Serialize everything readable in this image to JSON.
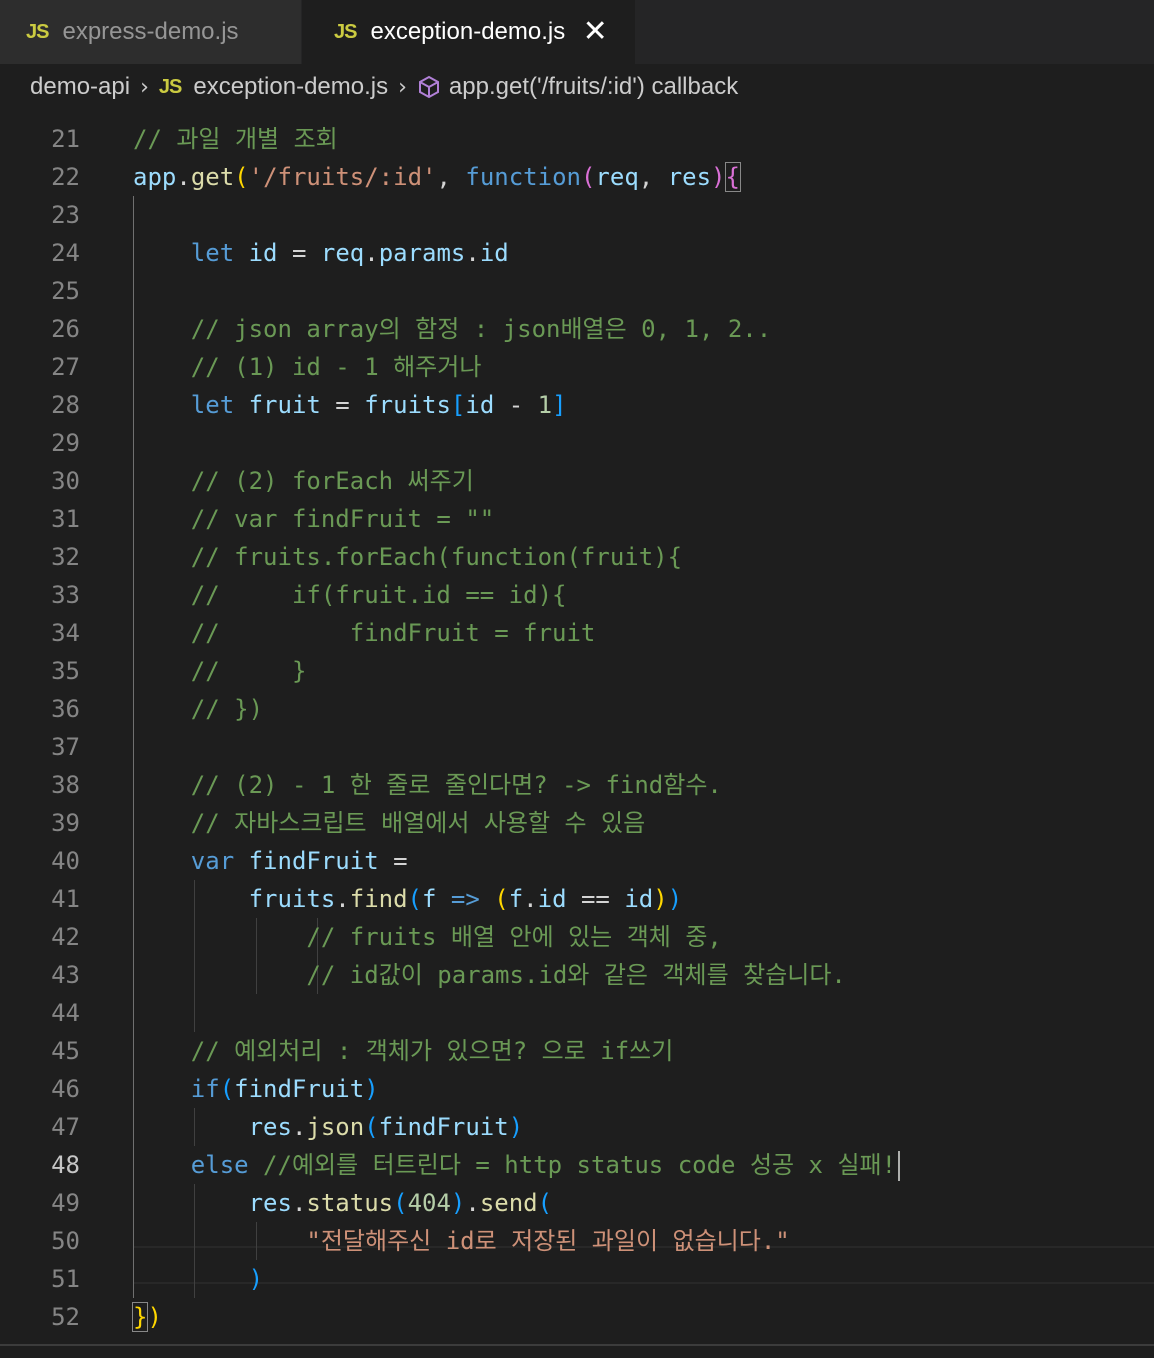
{
  "tabs": [
    {
      "icon": "JS",
      "label": "express-demo.js",
      "active": false
    },
    {
      "icon": "JS",
      "label": "exception-demo.js",
      "active": true,
      "close": "✕"
    }
  ],
  "breadcrumb": {
    "folder": "demo-api",
    "file_icon": "JS",
    "file": "exception-demo.js",
    "symbol": "app.get('/fruits/:id') callback"
  },
  "editor": {
    "current_line": 48,
    "lines": [
      {
        "n": "21",
        "tokens": [
          [
            "cm",
            "// 과일 개별 조회"
          ]
        ]
      },
      {
        "n": "22",
        "tokens": [
          [
            "vr",
            "app"
          ],
          [
            "",
            "."
          ],
          [
            "fn",
            "get"
          ],
          [
            "br1",
            "("
          ],
          [
            "st",
            "'/fruits/:id'"
          ],
          [
            "",
            ", "
          ],
          [
            "kw",
            "function"
          ],
          [
            "br2",
            "("
          ],
          [
            "vr",
            "req"
          ],
          [
            "",
            ", "
          ],
          [
            "vr",
            "res"
          ],
          [
            "br2",
            ")"
          ],
          [
            "br2box",
            "{"
          ]
        ]
      },
      {
        "n": "23",
        "tokens": []
      },
      {
        "n": "24",
        "tokens": [
          [
            "",
            "    "
          ],
          [
            "kw",
            "let"
          ],
          [
            "",
            " "
          ],
          [
            "vr",
            "id"
          ],
          [
            "",
            " = "
          ],
          [
            "vr",
            "req"
          ],
          [
            "",
            "."
          ],
          [
            "vr",
            "params"
          ],
          [
            "",
            "."
          ],
          [
            "vr",
            "id"
          ]
        ]
      },
      {
        "n": "25",
        "tokens": []
      },
      {
        "n": "26",
        "tokens": [
          [
            "",
            "    "
          ],
          [
            "cm",
            "// json array의 함정 : json배열은 0, 1, 2.."
          ]
        ]
      },
      {
        "n": "27",
        "tokens": [
          [
            "",
            "    "
          ],
          [
            "cm",
            "// (1) id - 1 해주거나"
          ]
        ]
      },
      {
        "n": "28",
        "tokens": [
          [
            "",
            "    "
          ],
          [
            "kw",
            "let"
          ],
          [
            "",
            " "
          ],
          [
            "vr",
            "fruit"
          ],
          [
            "",
            " = "
          ],
          [
            "vr",
            "fruits"
          ],
          [
            "br3",
            "["
          ],
          [
            "vr",
            "id"
          ],
          [
            "",
            " - "
          ],
          [
            "nm",
            "1"
          ],
          [
            "br3",
            "]"
          ]
        ]
      },
      {
        "n": "29",
        "tokens": []
      },
      {
        "n": "30",
        "tokens": [
          [
            "",
            "    "
          ],
          [
            "cm",
            "// (2) forEach 써주기"
          ]
        ]
      },
      {
        "n": "31",
        "tokens": [
          [
            "",
            "    "
          ],
          [
            "cm",
            "// var findFruit = \"\""
          ]
        ]
      },
      {
        "n": "32",
        "tokens": [
          [
            "",
            "    "
          ],
          [
            "cm",
            "// fruits.forEach(function(fruit){"
          ]
        ]
      },
      {
        "n": "33",
        "tokens": [
          [
            "",
            "    "
          ],
          [
            "cm",
            "//     if(fruit.id == id){"
          ]
        ]
      },
      {
        "n": "34",
        "tokens": [
          [
            "",
            "    "
          ],
          [
            "cm",
            "//         findFruit = fruit"
          ]
        ]
      },
      {
        "n": "35",
        "tokens": [
          [
            "",
            "    "
          ],
          [
            "cm",
            "//     }"
          ]
        ]
      },
      {
        "n": "36",
        "tokens": [
          [
            "",
            "    "
          ],
          [
            "cm",
            "// })"
          ]
        ]
      },
      {
        "n": "37",
        "tokens": []
      },
      {
        "n": "38",
        "tokens": [
          [
            "",
            "    "
          ],
          [
            "cm",
            "// (2) - 1 한 줄로 줄인다면? -> find함수."
          ]
        ]
      },
      {
        "n": "39",
        "tokens": [
          [
            "",
            "    "
          ],
          [
            "cm",
            "// 자바스크립트 배열에서 사용할 수 있음"
          ]
        ]
      },
      {
        "n": "40",
        "tokens": [
          [
            "",
            "    "
          ],
          [
            "kw",
            "var"
          ],
          [
            "",
            " "
          ],
          [
            "vr",
            "findFruit"
          ],
          [
            "",
            " ="
          ]
        ]
      },
      {
        "n": "41",
        "tokens": [
          [
            "",
            "        "
          ],
          [
            "vr",
            "fruits"
          ],
          [
            "",
            "."
          ],
          [
            "fn",
            "find"
          ],
          [
            "br3",
            "("
          ],
          [
            "vr",
            "f"
          ],
          [
            "",
            " "
          ],
          [
            "kw",
            "=>"
          ],
          [
            "",
            " "
          ],
          [
            "br1",
            "("
          ],
          [
            "vr",
            "f"
          ],
          [
            "",
            "."
          ],
          [
            "vr",
            "id"
          ],
          [
            "",
            " == "
          ],
          [
            "vr",
            "id"
          ],
          [
            "br1",
            ")"
          ],
          [
            "br3",
            ")"
          ]
        ]
      },
      {
        "n": "42",
        "tokens": [
          [
            "",
            "            "
          ],
          [
            "cm",
            "// fruits 배열 안에 있는 객체 중,"
          ]
        ]
      },
      {
        "n": "43",
        "tokens": [
          [
            "",
            "            "
          ],
          [
            "cm",
            "// id값이 params.id와 같은 객체를 찾습니다."
          ]
        ]
      },
      {
        "n": "44",
        "tokens": []
      },
      {
        "n": "45",
        "tokens": [
          [
            "",
            "    "
          ],
          [
            "cm",
            "// 예외처리 : 객체가 있으면? 으로 if쓰기"
          ]
        ]
      },
      {
        "n": "46",
        "tokens": [
          [
            "",
            "    "
          ],
          [
            "kw",
            "if"
          ],
          [
            "br3",
            "("
          ],
          [
            "vr",
            "findFruit"
          ],
          [
            "br3",
            ")"
          ]
        ]
      },
      {
        "n": "47",
        "tokens": [
          [
            "",
            "        "
          ],
          [
            "vr",
            "res"
          ],
          [
            "",
            "."
          ],
          [
            "fn",
            "json"
          ],
          [
            "br3",
            "("
          ],
          [
            "vr",
            "findFruit"
          ],
          [
            "br3",
            ")"
          ]
        ]
      },
      {
        "n": "48",
        "tokens": [
          [
            "",
            "    "
          ],
          [
            "kw",
            "else"
          ],
          [
            "",
            " "
          ],
          [
            "cm",
            "//예외를 터트린다 = http status code 성공 x 실패!"
          ]
        ]
      },
      {
        "n": "49",
        "tokens": [
          [
            "",
            "        "
          ],
          [
            "vr",
            "res"
          ],
          [
            "",
            "."
          ],
          [
            "fn",
            "status"
          ],
          [
            "br3",
            "("
          ],
          [
            "nm",
            "404"
          ],
          [
            "br3",
            ")"
          ],
          [
            "",
            "."
          ],
          [
            "fn",
            "send"
          ],
          [
            "br3",
            "("
          ]
        ]
      },
      {
        "n": "50",
        "tokens": [
          [
            "",
            "            "
          ],
          [
            "st",
            "\"전달해주신 id로 저장된 과일이 없습니다.\""
          ]
        ]
      },
      {
        "n": "51",
        "tokens": [
          [
            "",
            "        "
          ],
          [
            "br3",
            ")"
          ]
        ]
      },
      {
        "n": "52",
        "tokens": [
          [
            "br1box",
            "}"
          ],
          [
            "br1",
            ")"
          ]
        ]
      }
    ]
  }
}
